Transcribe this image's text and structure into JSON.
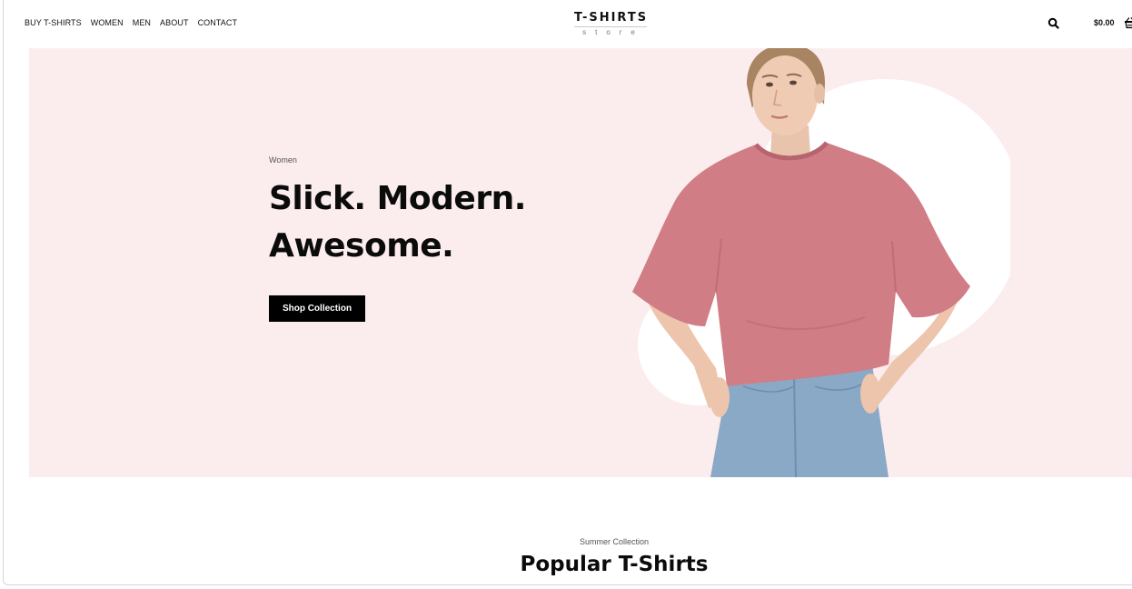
{
  "header": {
    "nav": [
      {
        "label": "BUY T-SHIRTS"
      },
      {
        "label": "WOMEN"
      },
      {
        "label": "MEN"
      },
      {
        "label": "ABOUT"
      },
      {
        "label": "CONTACT"
      }
    ],
    "logo": {
      "title": "T-SHIRTS",
      "subtitle": "store"
    },
    "search_icon": "search-icon",
    "cart": {
      "total": "$0.00",
      "icon": "basket-icon"
    }
  },
  "hero": {
    "kicker": "Women",
    "title_line1": "Slick. Modern.",
    "title_line2": "Awesome.",
    "cta_label": "Shop Collection",
    "background_color": "#fbeded",
    "shirt_color": "#d07d86",
    "jeans_color": "#8aa9c6"
  },
  "section": {
    "kicker": "Summer Collection",
    "title": "Popular T-Shirts"
  }
}
